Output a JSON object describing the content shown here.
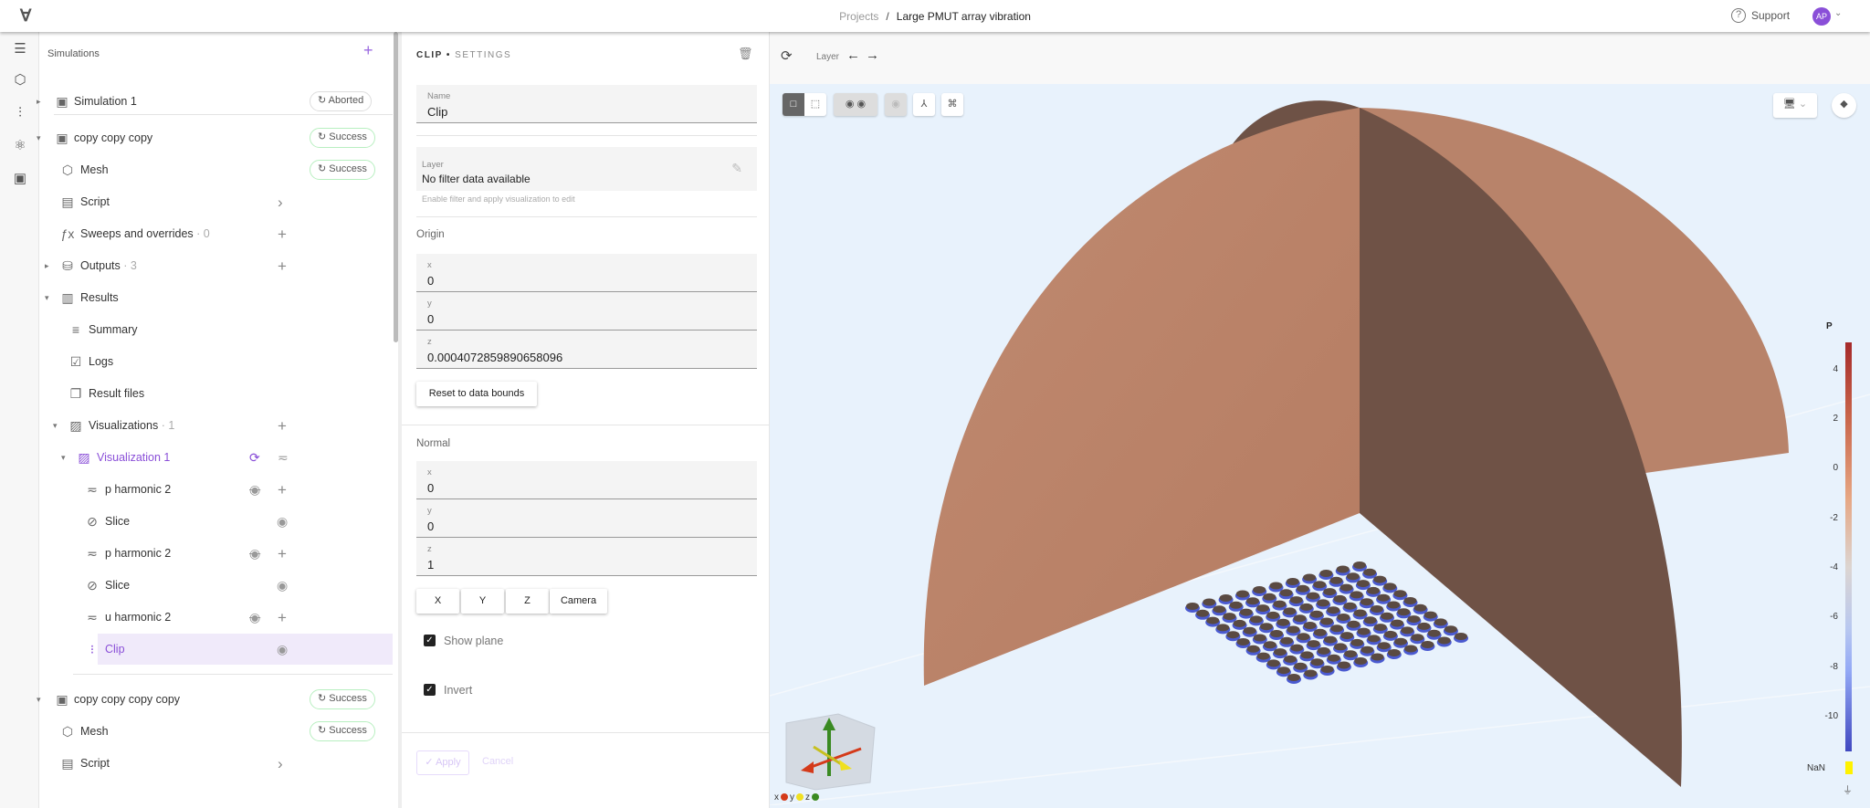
{
  "topbar": {
    "logo": "∀",
    "breadcrumb_root": "Projects",
    "breadcrumb_sep": "/",
    "breadcrumb_current": "Large PMUT array vibration",
    "support": "Support",
    "avatar": "AP"
  },
  "tree": {
    "title": "Simulations",
    "rows": [
      {
        "label": "Simulation 1",
        "badge": "Aborted"
      },
      {
        "label": "copy copy copy",
        "badge": "Success"
      },
      {
        "label": "Mesh",
        "badge": "Success"
      },
      {
        "label": "Script"
      },
      {
        "label": "Sweeps and overrides",
        "count": "· 0"
      },
      {
        "label": "Outputs",
        "count": "· 3"
      },
      {
        "label": "Results"
      },
      {
        "label": "Summary"
      },
      {
        "label": "Logs"
      },
      {
        "label": "Result files"
      },
      {
        "label": "Visualizations",
        "count": "· 1"
      },
      {
        "label": "Visualization 1"
      },
      {
        "label": "p harmonic 2"
      },
      {
        "label": "Slice"
      },
      {
        "label": "p harmonic 2"
      },
      {
        "label": "Slice"
      },
      {
        "label": "u harmonic 2"
      },
      {
        "label": "Clip"
      },
      {
        "label": "copy copy copy copy",
        "badge": "Success"
      },
      {
        "label": "Mesh",
        "badge": "Success"
      },
      {
        "label": "Script"
      }
    ]
  },
  "settings": {
    "title": "CLIP",
    "title_sep": " • ",
    "subtitle": "SETTINGS",
    "name_label": "Name",
    "name_value": "Clip",
    "layer_label": "Layer",
    "layer_value": "No filter data available",
    "layer_hint": "Enable filter and apply visualization to edit",
    "origin_label": "Origin",
    "origin": {
      "x": "0",
      "y": "0",
      "z": "0.0004072859890658096"
    },
    "reset_button": "Reset to data bounds",
    "normal_label": "Normal",
    "normal": {
      "x": "0",
      "y": "0",
      "z": "1"
    },
    "axis_buttons": [
      "X",
      "Y",
      "Z",
      "Camera"
    ],
    "show_plane": "Show plane",
    "show_plane_checked": true,
    "invert": "Invert",
    "invert_checked": true,
    "apply": "Apply",
    "cancel": "Cancel"
  },
  "viewport": {
    "layer_label": "Layer",
    "colorbar": {
      "title": "P",
      "ticks": [
        "4",
        "2",
        "0",
        "-2",
        "-4",
        "-6",
        "-8",
        "-10"
      ],
      "tick_values": [
        4,
        2,
        0,
        -2,
        -4,
        -6,
        -8,
        -10
      ],
      "range": [
        -11.4,
        5.1
      ],
      "nan_label": "NaN",
      "nan_color": "#fff200"
    },
    "axes": {
      "x": "x",
      "y": "y",
      "z": "z"
    }
  },
  "colors": {
    "accent": "#8a4fd8",
    "success_border": "#b8efc0",
    "field_bg": "#f4f4f4",
    "viewport_bg": "#e8f2fc"
  }
}
